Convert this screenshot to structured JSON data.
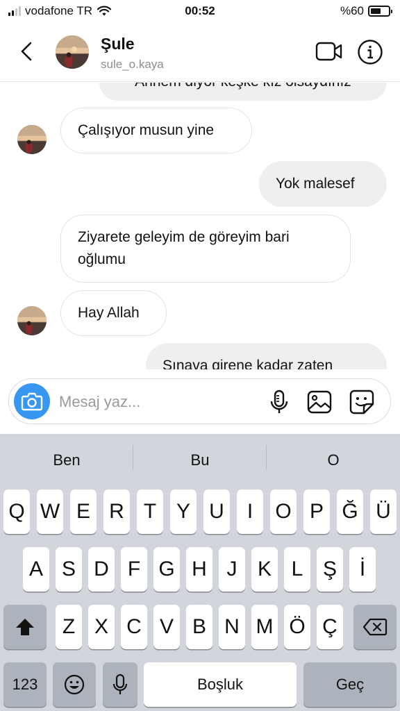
{
  "status_bar": {
    "carrier": "vodafone TR",
    "time": "00:52",
    "battery_label": "%60",
    "battery_level": 0.6
  },
  "header": {
    "name": "Şule",
    "username": "sule_o.kaya",
    "icons": {
      "back": "chevron-left-icon",
      "video": "video-call-icon",
      "info": "info-icon"
    }
  },
  "messages": [
    {
      "direction": "outgoing",
      "text": "Annem diyor keşke kız olsaydınız",
      "partial": true
    },
    {
      "direction": "incoming",
      "text": "Çalışıyor musun yine"
    },
    {
      "direction": "outgoing",
      "text": "Yok malesef"
    },
    {
      "direction": "incoming",
      "line1": "Ziyarete geleyim de göreyim bari",
      "line2": "oğlumu"
    },
    {
      "direction": "incoming",
      "text": "Hay Allah"
    },
    {
      "direction": "outgoing",
      "text": "Sınava girene kadar zaten",
      "partial": true
    }
  ],
  "composer": {
    "placeholder": "Mesaj yaz...",
    "icons": [
      "camera-icon",
      "microphone-icon",
      "gallery-icon",
      "sticker-icon"
    ]
  },
  "keyboard": {
    "suggestions": [
      "Ben",
      "Bu",
      "O"
    ],
    "row1": [
      "Q",
      "W",
      "E",
      "R",
      "T",
      "Y",
      "U",
      "I",
      "O",
      "P",
      "Ğ",
      "Ü"
    ],
    "row2": [
      "A",
      "S",
      "D",
      "F",
      "G",
      "H",
      "J",
      "K",
      "L",
      "Ş",
      "İ"
    ],
    "row3": [
      "Z",
      "X",
      "C",
      "V",
      "B",
      "N",
      "M",
      "Ö",
      "Ç"
    ],
    "numbers_label": "123",
    "space_label": "Boşluk",
    "return_label": "Geç",
    "icons": {
      "shift": "shift-icon",
      "delete": "backspace-icon",
      "emoji": "emoji-icon",
      "dictation": "microphone-icon"
    }
  },
  "colors": {
    "accent": "#3897f0",
    "incoming_border": "#e3e3e3",
    "outgoing_bg": "#efefef",
    "keyboard_bg": "#d2d5db",
    "function_key": "#adb3bc"
  }
}
